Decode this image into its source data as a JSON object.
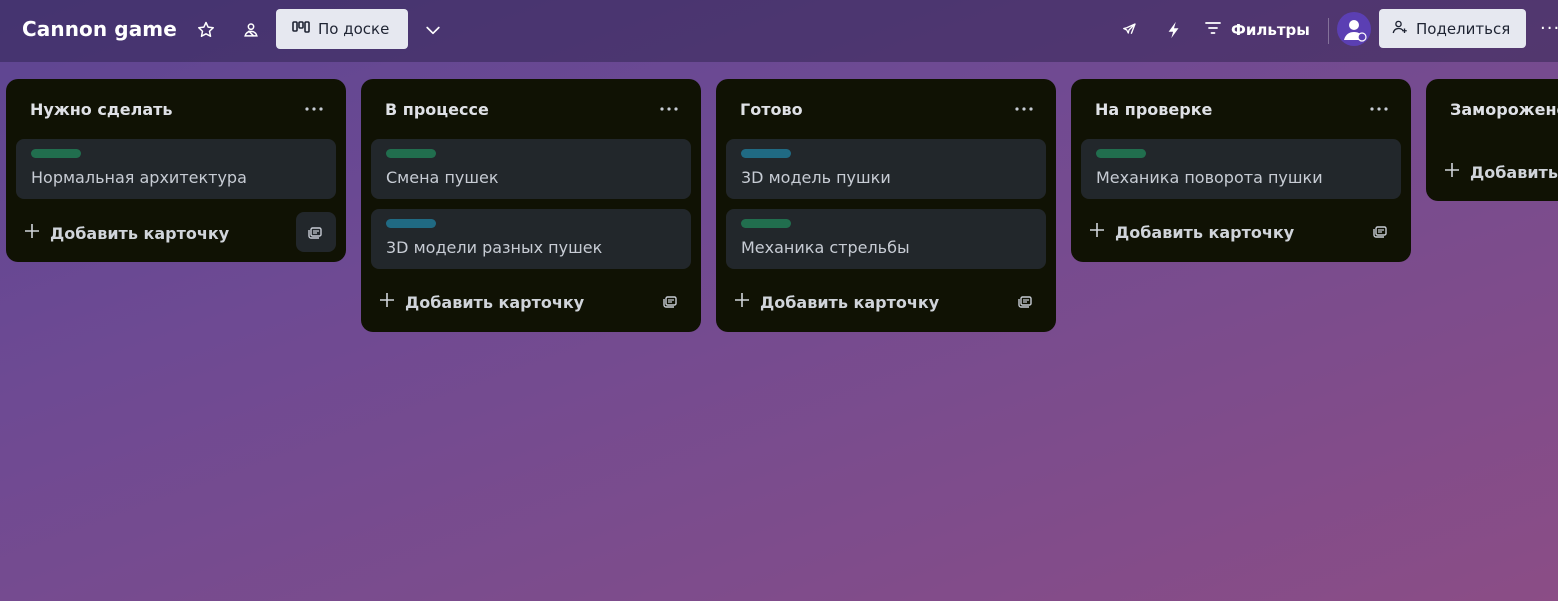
{
  "board": {
    "title": "Cannon game",
    "view_label": "По доске",
    "filters_label": "Фильтры",
    "share_label": "Поделиться",
    "more": "···"
  },
  "colors": {
    "label_green": "#216e4e",
    "label_teal": "#206a83"
  },
  "icons": [
    "star-icon",
    "team-visibility-icon",
    "board-view-icon",
    "chevron-down-icon",
    "rocket-icon",
    "automation-bolt-icon",
    "filter-icon",
    "avatar-icon",
    "add-person-icon",
    "more-icon",
    "plus-icon",
    "card-template-icon"
  ],
  "lists": [
    {
      "title": "Нужно сделать",
      "add_label": "Добавить карточку",
      "cards": [
        {
          "label_color": "green",
          "text": "Нормальная архитектура"
        }
      ]
    },
    {
      "title": "В процессе",
      "add_label": "Добавить карточку",
      "cards": [
        {
          "label_color": "green",
          "text": "Смена пушек"
        },
        {
          "label_color": "teal",
          "text": "3D модели разных пушек"
        }
      ]
    },
    {
      "title": "Готово",
      "add_label": "Добавить карточку",
      "cards": [
        {
          "label_color": "teal",
          "text": "3D модель пушки"
        },
        {
          "label_color": "green",
          "text": "Механика стрельбы"
        }
      ]
    },
    {
      "title": "На проверке",
      "add_label": "Добавить карточку",
      "cards": [
        {
          "label_color": "green",
          "text": "Механика поворота пушки"
        }
      ]
    },
    {
      "title": "Заморожено",
      "add_label": "Добавить",
      "cards": []
    }
  ]
}
